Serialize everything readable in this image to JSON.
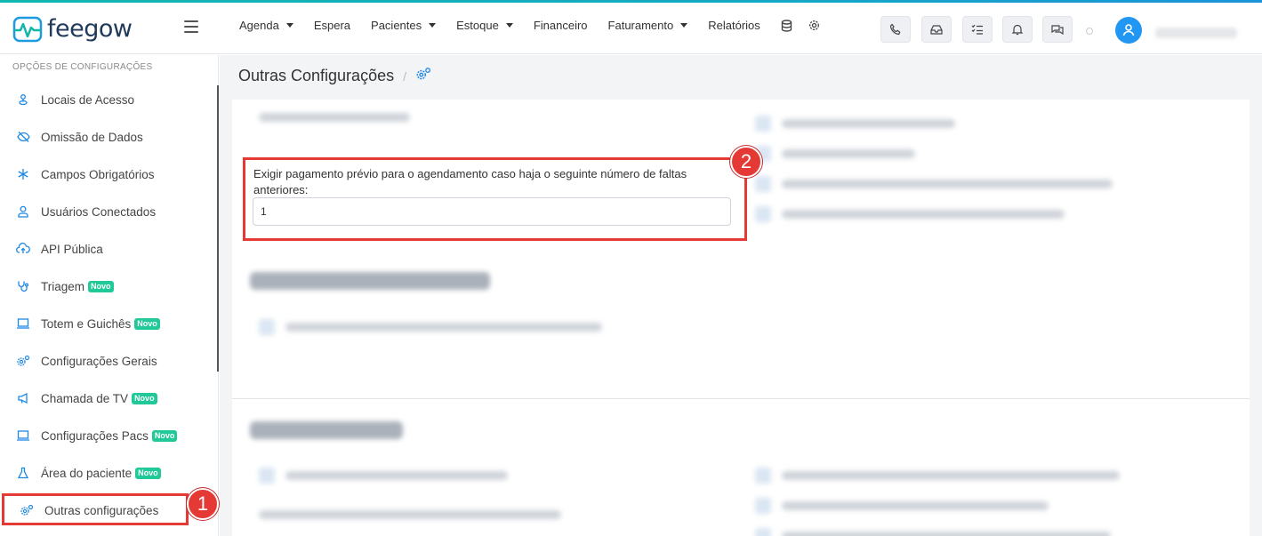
{
  "brand": {
    "name": "feegow",
    "accent": "#1e88e5",
    "logo_color": "#203a5c"
  },
  "nav": {
    "items": [
      {
        "label": "Agenda",
        "dropdown": true
      },
      {
        "label": "Espera",
        "dropdown": false
      },
      {
        "label": "Pacientes",
        "dropdown": true
      },
      {
        "label": "Estoque",
        "dropdown": true
      },
      {
        "label": "Financeiro",
        "dropdown": false
      },
      {
        "label": "Faturamento",
        "dropdown": true
      },
      {
        "label": "Relatórios",
        "dropdown": false
      }
    ],
    "icons": [
      "database-icon",
      "gear-icon"
    ]
  },
  "toolbar": {
    "icons": [
      "phone-icon",
      "inbox-icon",
      "checklist-icon",
      "bell-icon",
      "chat-icon"
    ]
  },
  "sidebar": {
    "heading": "OPÇÕES DE CONFIGURAÇÕES",
    "items": [
      {
        "label": "Locais de Acesso",
        "icon": "location-icon",
        "badge": ""
      },
      {
        "label": "Omissão de Dados",
        "icon": "eye-off-icon",
        "badge": ""
      },
      {
        "label": "Campos Obrigatórios",
        "icon": "asterisk-icon",
        "badge": ""
      },
      {
        "label": "Usuários Conectados",
        "icon": "user-icon",
        "badge": ""
      },
      {
        "label": "API Pública",
        "icon": "cloud-upload-icon",
        "badge": ""
      },
      {
        "label": "Triagem",
        "icon": "stethoscope-icon",
        "badge": "Novo"
      },
      {
        "label": "Totem e Guichês",
        "icon": "laptop-icon",
        "badge": "Novo"
      },
      {
        "label": "Configurações Gerais",
        "icon": "gears-icon",
        "badge": ""
      },
      {
        "label": "Chamada de TV",
        "icon": "megaphone-icon",
        "badge": "Novo"
      },
      {
        "label": "Configurações Pacs",
        "icon": "laptop-icon",
        "badge": "Novo"
      },
      {
        "label": "Área do paciente",
        "icon": "flask-icon",
        "badge": "Novo"
      },
      {
        "label": "Outras configurações",
        "icon": "gears-icon",
        "badge": ""
      }
    ]
  },
  "main": {
    "breadcrumb_title": "Outras Configurações",
    "breadcrumb_sep": "/",
    "field": {
      "label": "Exigir pagamento prévio para o agendamento caso haja o seguinte número de faltas anteriores:",
      "value": "1"
    }
  },
  "annotations": {
    "step1": "1",
    "step2": "2",
    "highlight_color": "#e53935"
  }
}
